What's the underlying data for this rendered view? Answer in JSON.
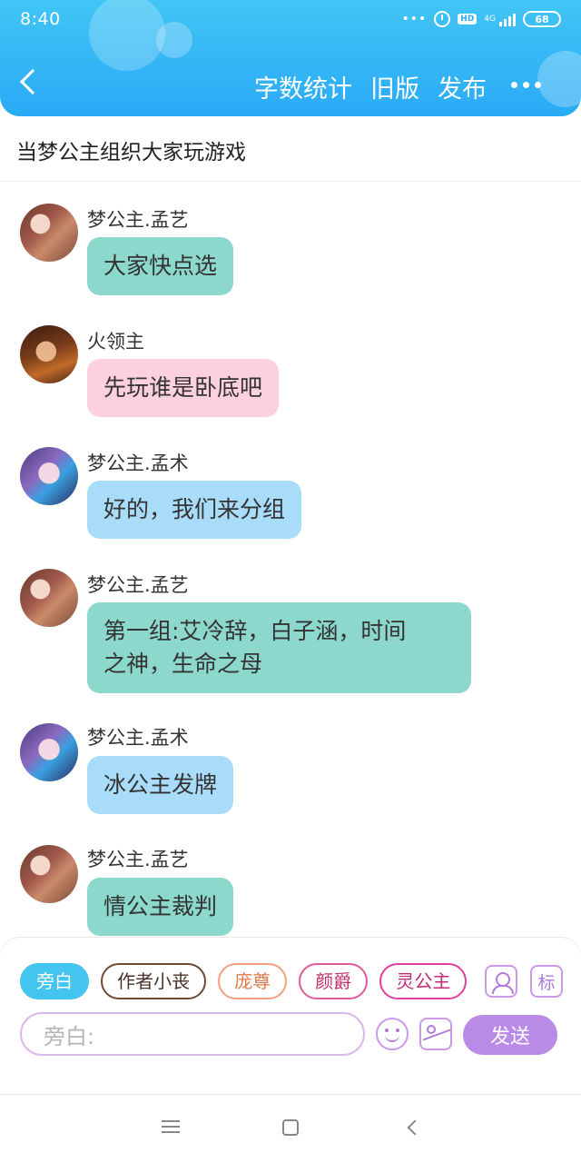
{
  "status_bar": {
    "time": "8:40",
    "network_label": "4G",
    "hd_label": "HD",
    "battery": "68"
  },
  "header": {
    "actions": [
      "字数统计",
      "旧版",
      "发布"
    ]
  },
  "title": "当梦公主组织大家玩游戏",
  "messages": [
    {
      "sender": "梦公主.孟艺",
      "text": "大家快点选",
      "bubble_color": "#8dd8cc",
      "avatar": "mengyi-avatar"
    },
    {
      "sender": "火领主",
      "text": "先玩谁是卧底吧",
      "bubble_color": "#fcd0dc",
      "avatar": "huo-avatar"
    },
    {
      "sender": "梦公主.孟术",
      "text": "好的，我们来分组",
      "bubble_color": "#a9dcf9",
      "avatar": "mengshu-avatar"
    },
    {
      "sender": "梦公主.孟艺",
      "text_lines": [
        "第一组:艾冷辞，白子涵，时间",
        "之神，生命之母"
      ],
      "bubble_color": "#8dd8cc",
      "avatar": "mengyi-avatar"
    },
    {
      "sender": "梦公主.孟术",
      "text": "冰公主发牌",
      "bubble_color": "#a9dcf9",
      "avatar": "mengshu-avatar"
    },
    {
      "sender": "梦公主.孟艺",
      "text": "情公主裁判",
      "bubble_color": "#8dd8cc",
      "avatar": "mengyi-avatar"
    }
  ],
  "role_tags": [
    {
      "label": "旁白",
      "active": true
    },
    {
      "label": "作者小丧",
      "active": false
    },
    {
      "label": "庞尊",
      "active": false
    },
    {
      "label": "颜爵",
      "active": false
    },
    {
      "label": "灵公主",
      "active": false
    }
  ],
  "tool_icons": {
    "mark_label": "标"
  },
  "input": {
    "placeholder": "旁白:"
  },
  "send_label": "发送",
  "colors": {
    "header_gradient_top": "#41c5f5",
    "header_gradient_bottom": "#2aaaf6",
    "accent_purple": "#b98ae6",
    "active_tag": "#43c5f0"
  }
}
